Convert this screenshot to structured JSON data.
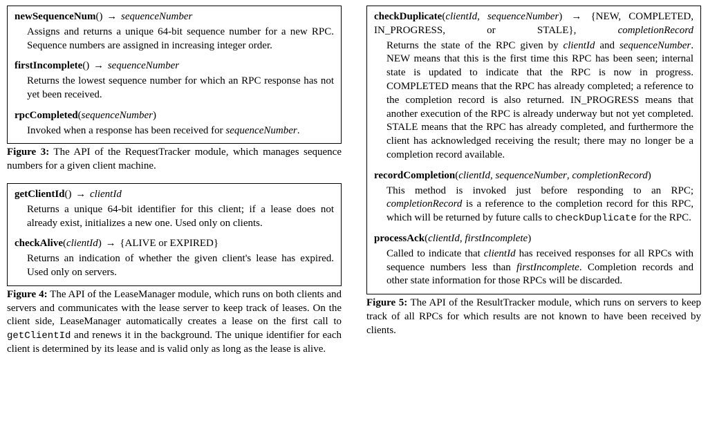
{
  "col_left": {
    "fig3": {
      "entries": [
        {
          "name": "newSequenceNum",
          "args": "()",
          "ret": "sequenceNumber",
          "desc": "Assigns and returns a unique 64-bit sequence number for a new RPC. Sequence numbers are assigned in increasing integer order."
        },
        {
          "name": "firstIncomplete",
          "args": "()",
          "ret": "sequenceNumber",
          "desc": "Returns the lowest sequence number for which an RPC response has not yet been received."
        },
        {
          "name": "rpcCompleted",
          "args_open": "(",
          "arg1": "sequenceNumber",
          "args_close": ")",
          "desc_a": "Invoked when a response has been received for ",
          "desc_i": "sequen­ceNumber",
          "desc_b": "."
        }
      ],
      "caption_label": "Figure 3:",
      "caption_text": " The API of the RequestTracker module, which man­ages sequence numbers for a given client machine."
    },
    "fig4": {
      "entries": [
        {
          "name": "getClientId",
          "args": "()",
          "ret": "clientId",
          "desc": "Returns a unique 64-bit identifier for this client; if a lease does not already exist, initializes a new one. Used only on clients."
        },
        {
          "name": "checkAlive",
          "args_open": "(",
          "arg1": "clientId",
          "args_close": ")",
          "ret": "{ALIVE or EXPIRED}",
          "desc": "Returns an indication of whether the given client's lease has expired. Used only on servers."
        }
      ],
      "caption_label": "Figure 4:",
      "caption_text_a": " The API of the LeaseManager module, which runs on both clients and servers and communicates with the lease server to keep track of leases. On the client side, LeaseManager automatically creates a lease on the first call to ",
      "caption_code": "getClientId",
      "caption_text_b": " and renews it in the background. The unique identifier for each client is determined by its lease and is valid only as long as the lease is alive."
    }
  },
  "col_right": {
    "fig5": {
      "e1": {
        "name": "checkDuplicate",
        "args_open": "(",
        "arg1": "clientId",
        "comma": ", ",
        "arg2": "sequenceNumber",
        "args_close": ")",
        "ret_a": "{NEW, COMPLETED, IN_PROGRESS, or STALE}, ",
        "ret_i": "completion­Record",
        "d_a": "Returns the state of the RPC given by ",
        "d_i1": "clientId",
        "d_b": " and ",
        "d_i2": "sequen­ceNumber",
        "d_c": ". NEW means that this is the first time this RPC has been seen; internal state is updated to indicate that the RPC is now in progress. COMPLETED means that the RPC has already completed; a reference to the completion record is also returned. IN_PROGRESS means that another execution of the RPC is already underway but not yet com­pleted. STALE means that the RPC has already completed, and furthermore the client has acknowledged receiving the result; there may no longer be a completion record avail­able."
      },
      "e2": {
        "name": "recordCompletion",
        "args_open": "(",
        "arg1": "clientId",
        "c1": ", ",
        "arg2": "sequenceNumber",
        "c2": ", ",
        "arg3": "completion­Record",
        "args_close": ")",
        "d_a": "This method is invoked just before responding to an RPC; ",
        "d_i1": "completionRecord",
        "d_b": " is a reference to the completion record for this RPC, which will be returned by future calls to ",
        "d_code": "checkDuplicate",
        "d_c": " for the RPC."
      },
      "e3": {
        "name": "processAck",
        "args_open": "(",
        "arg1": "clientId",
        "c1": ", ",
        "arg2": "firstIncomplete",
        "args_close": ")",
        "d_a": "Called to indicate that ",
        "d_i1": "clientId",
        "d_b": " has received responses for all RPCs with sequence numbers less than ",
        "d_i2": "firstIncomplete",
        "d_c": ". Completion records and other state information for those RPCs will be discarded."
      },
      "caption_label": "Figure 5:",
      "caption_text": " The API of the ResultTracker module, which runs on servers to keep track of all RPCs for which results are not known to have been received by clients."
    }
  },
  "glyphs": {
    "arrow": "→"
  }
}
